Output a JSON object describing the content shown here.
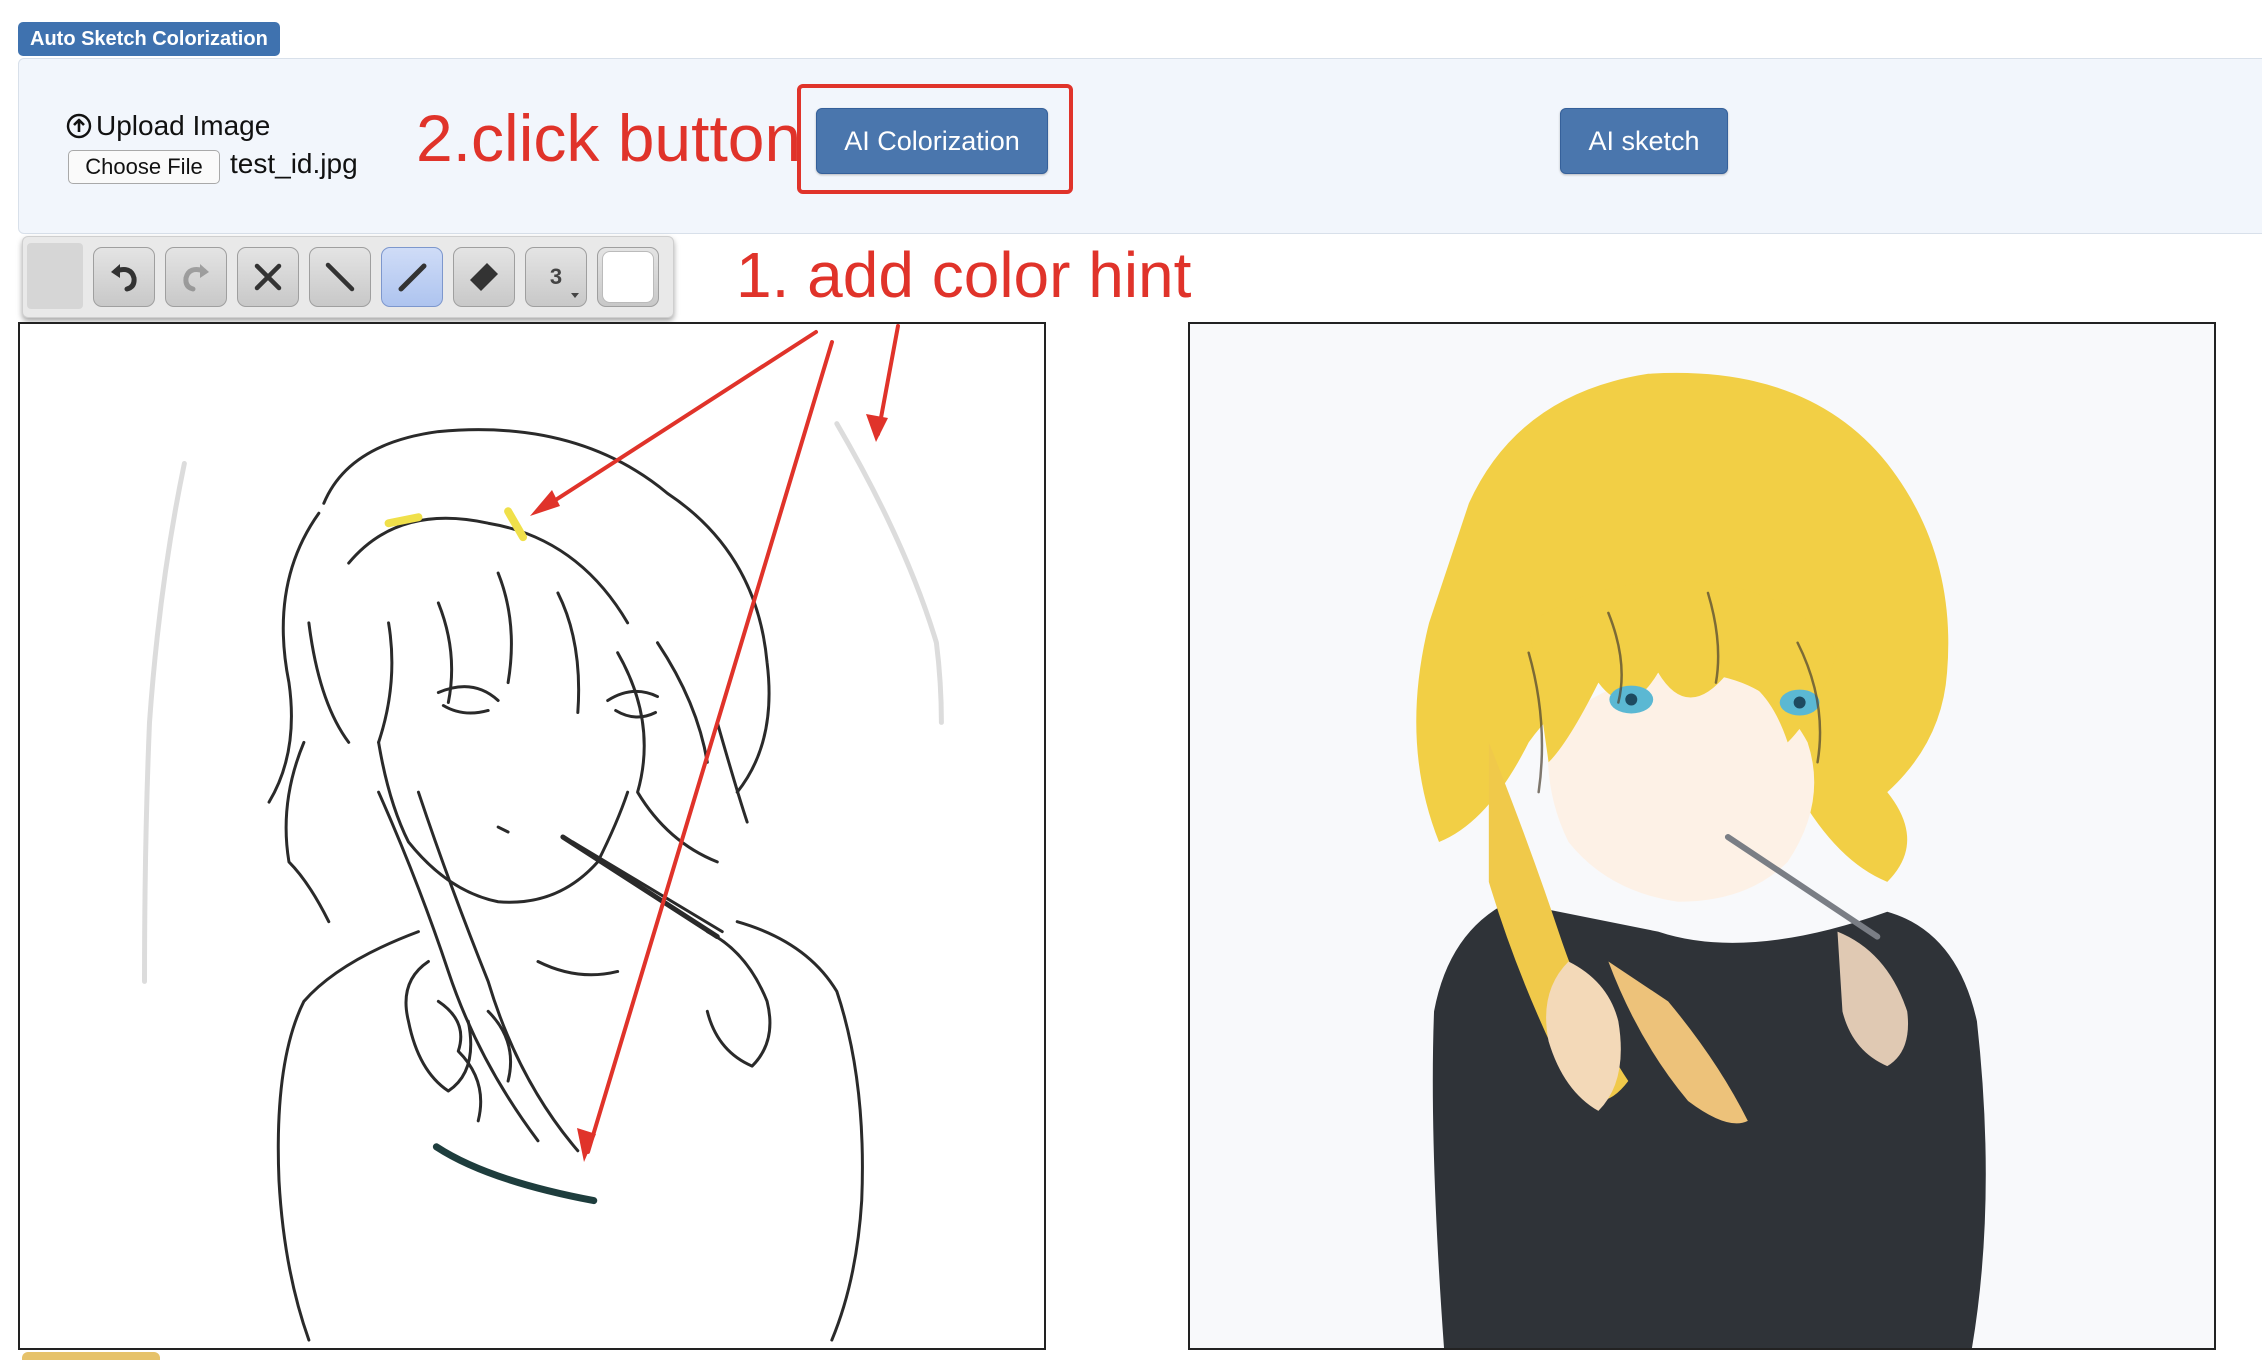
{
  "app": {
    "tag_label": "Auto Sketch Colorization"
  },
  "upload": {
    "label": "Upload Image",
    "choose_button": "Choose File",
    "file_name": "test_id.jpg"
  },
  "buttons": {
    "colorize": "AI Colorization",
    "sketch": "AI sketch"
  },
  "annotations": {
    "step2": "2.click button",
    "step1": "1. add color hint",
    "color": "#e0332a"
  },
  "toolbar": {
    "tools": [
      "undo-icon",
      "redo-icon",
      "clear-icon",
      "line-icon",
      "pen-icon",
      "eraser-icon",
      "brush-size",
      "color-swatch"
    ],
    "brush_size": "3",
    "active_tool": "pen-icon",
    "swatch_color": "#ffffff"
  },
  "colors": {
    "primary_button": "#4a76ad",
    "panel_background": "#f2f6fc",
    "hint_yellow": "#f0e04a",
    "hint_dark": "#1e3d3d",
    "hair": "#f2cf45",
    "shirt": "#2f3338"
  }
}
